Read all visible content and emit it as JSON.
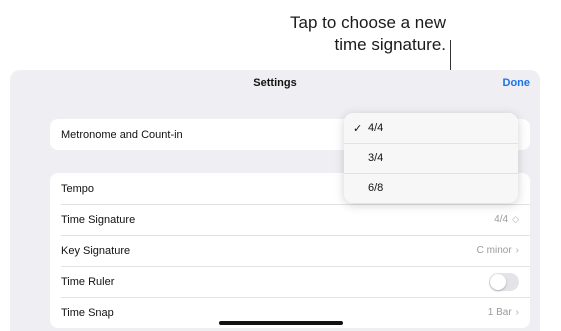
{
  "callout": {
    "line1": "Tap to choose a new",
    "line2": "time signature."
  },
  "nav": {
    "title": "Settings",
    "done_label": "Done",
    "accent": "#1a73e8"
  },
  "group1": {
    "metronome_label": "Metronome and Count-in"
  },
  "group2": {
    "tempo_label": "Tempo",
    "time_signature_label": "Time Signature",
    "time_signature_value": "4/4",
    "key_signature_label": "Key Signature",
    "key_signature_value": "C minor",
    "time_ruler_label": "Time Ruler",
    "time_ruler_on": false,
    "time_snap_label": "Time Snap",
    "time_snap_value": "1 Bar"
  },
  "menu": {
    "options": [
      "4/4",
      "3/4",
      "6/8"
    ],
    "selected": "4/4",
    "check_glyph": "✓"
  },
  "icons": {
    "chevron": "›",
    "updown": "◇"
  }
}
